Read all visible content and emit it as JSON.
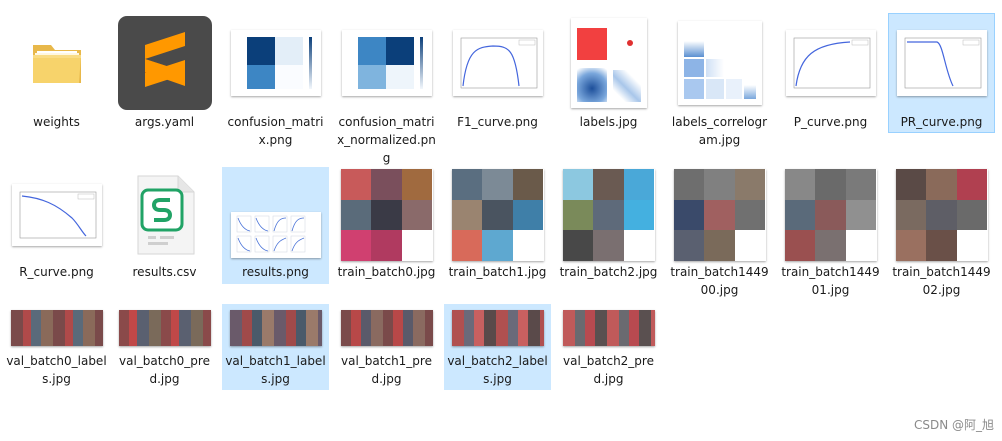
{
  "files": [
    {
      "name": "weights"
    },
    {
      "name": "args.yaml"
    },
    {
      "name": "confusion_matrix.png"
    },
    {
      "name": "confusion_matrix_normalized.png"
    },
    {
      "name": "F1_curve.png"
    },
    {
      "name": "labels.jpg"
    },
    {
      "name": "labels_correlogram.jpg"
    },
    {
      "name": "P_curve.png"
    },
    {
      "name": "PR_curve.png"
    },
    {
      "name": "R_curve.png"
    },
    {
      "name": "results.csv"
    },
    {
      "name": "results.png"
    },
    {
      "name": "train_batch0.jpg"
    },
    {
      "name": "train_batch1.jpg"
    },
    {
      "name": "train_batch2.jpg"
    },
    {
      "name": "train_batch144900.jpg"
    },
    {
      "name": "train_batch144901.jpg"
    },
    {
      "name": "train_batch144902.jpg"
    },
    {
      "name": "val_batch0_labels.jpg"
    },
    {
      "name": "val_batch0_pred.jpg"
    },
    {
      "name": "val_batch1_labels.jpg"
    },
    {
      "name": "val_batch1_pred.jpg"
    },
    {
      "name": "val_batch2_labels.jpg"
    },
    {
      "name": "val_batch2_pred.jpg"
    }
  ],
  "selection": {
    "selected_files": [
      "results.png",
      "val_batch1_labels.jpg",
      "val_batch2_labels.jpg"
    ],
    "focused_file": "PR_curve.png",
    "color": "#cce8ff"
  },
  "watermark": "CSDN @阿_旭"
}
